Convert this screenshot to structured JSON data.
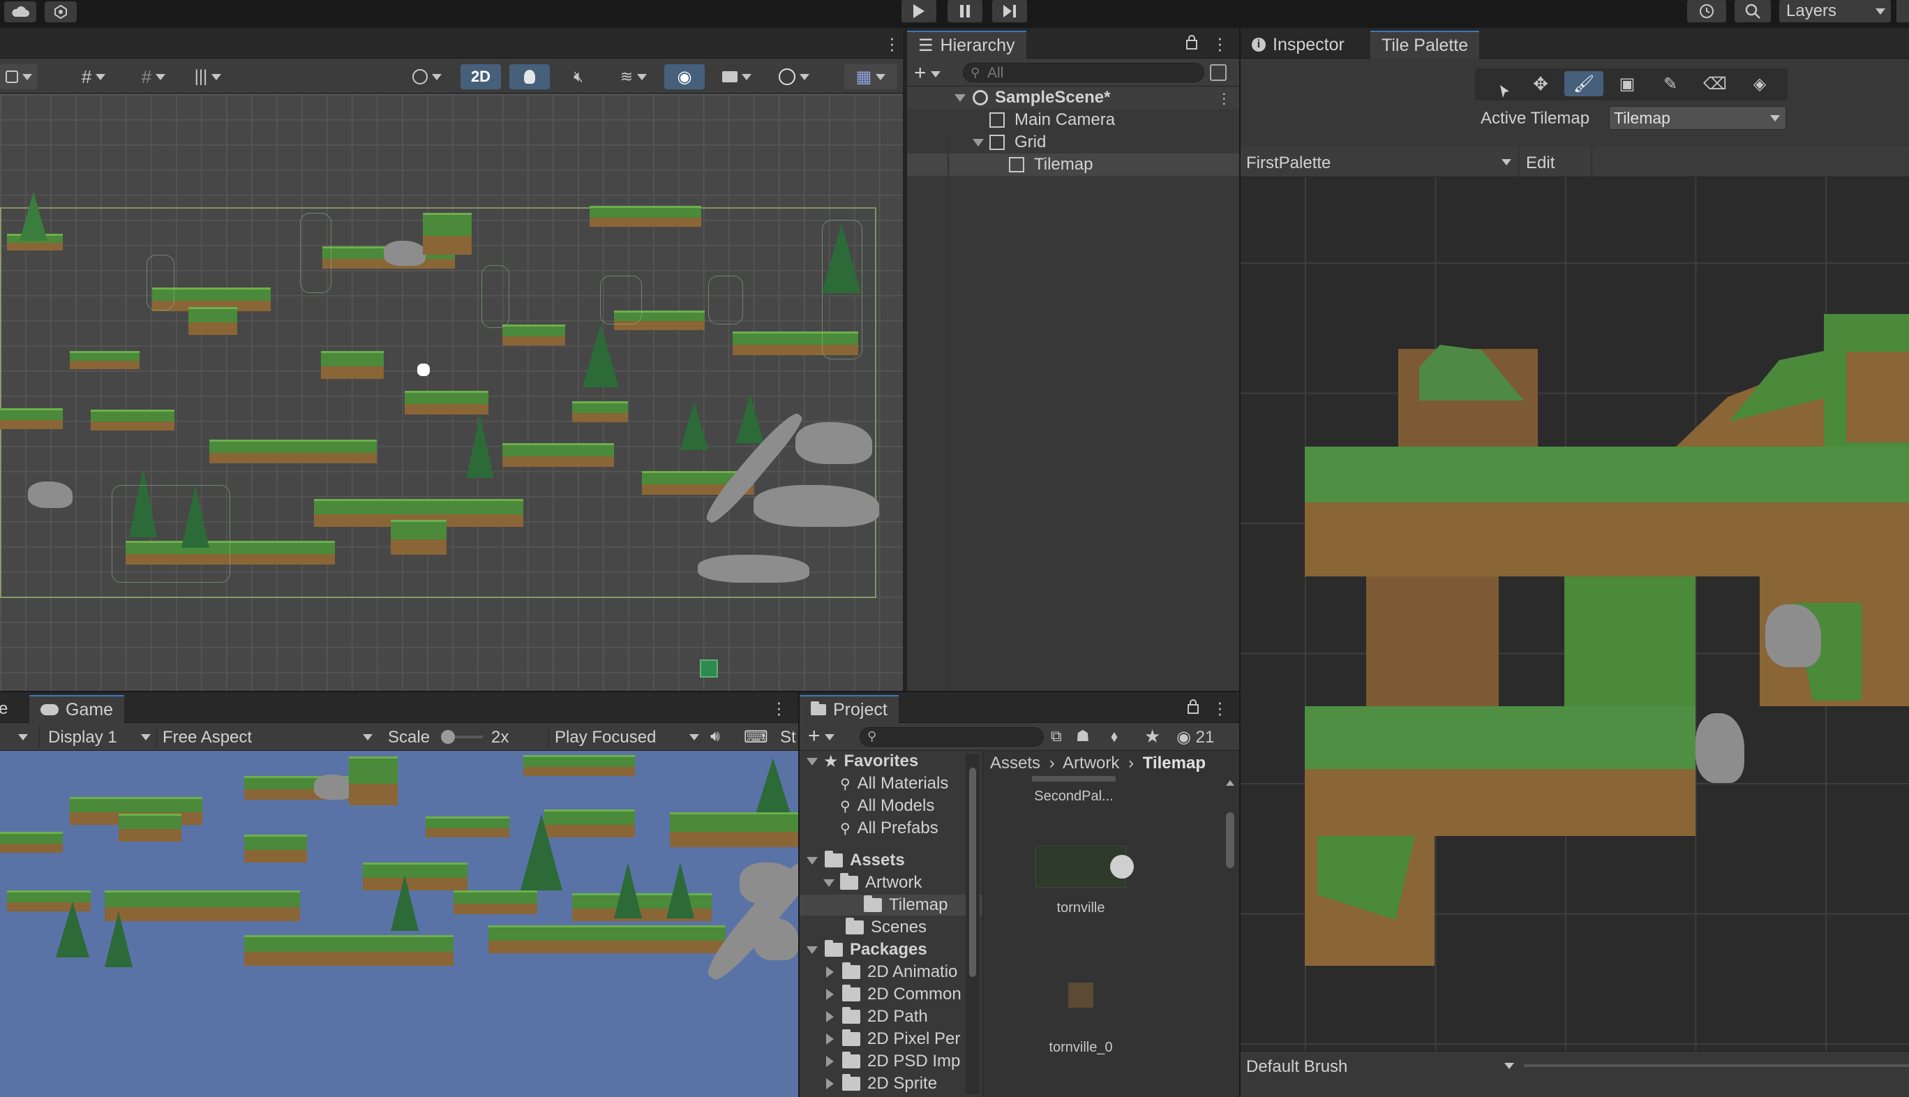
{
  "top_toolbar": {
    "layers_label": "Layers",
    "play_icon": "play-icon",
    "pause_icon": "pause-icon",
    "step_icon": "step-icon"
  },
  "scene_view": {
    "mode_2d_label": "2D"
  },
  "hierarchy": {
    "tab_label": "Hierarchy",
    "search_placeholder": "All",
    "items": [
      {
        "label": "SampleScene*",
        "level": 0
      },
      {
        "label": "Main Camera",
        "level": 1
      },
      {
        "label": "Grid",
        "level": 1
      },
      {
        "label": "Tilemap",
        "level": 2
      }
    ]
  },
  "inspector_tabs": {
    "inspector_label": "Inspector",
    "tile_palette_label": "Tile Palette"
  },
  "tile_palette": {
    "active_tilemap_label": "Active Tilemap",
    "active_tilemap_value": "Tilemap",
    "palette_value": "FirstPalette",
    "edit_label": "Edit",
    "brush_value": "Default Brush"
  },
  "game_view": {
    "tab_label": "Game",
    "display_value": "Display 1",
    "aspect_value": "Free Aspect",
    "scale_label": "Scale",
    "scale_value": "2x",
    "play_mode_value": "Play Focused",
    "stats_label": "St"
  },
  "project": {
    "tab_label": "Project",
    "hidden_count": "21",
    "breadcrumb": [
      "Assets",
      "Artwork",
      "Tilemap"
    ],
    "tree": {
      "favorites_label": "Favorites",
      "favorites": [
        "All Materials",
        "All Models",
        "All Prefabs"
      ],
      "assets_label": "Assets",
      "artwork_label": "Artwork",
      "tilemap_label": "Tilemap",
      "scenes_label": "Scenes",
      "packages_label": "Packages",
      "packages": [
        "2D Animatio",
        "2D Common",
        "2D Path",
        "2D Pixel Per",
        "2D PSD Imp",
        "2D Sprite"
      ]
    },
    "files": [
      {
        "name": "SecondPal..."
      },
      {
        "name": "tornville"
      },
      {
        "name": "tornville_0"
      }
    ]
  },
  "colors": {
    "accent": "#3a79bb",
    "panel_bg": "#383838",
    "scene_bg": "#474747",
    "game_sky": "#5a73a6",
    "grass": "#4a8a3a",
    "dirt": "#8a6536"
  }
}
